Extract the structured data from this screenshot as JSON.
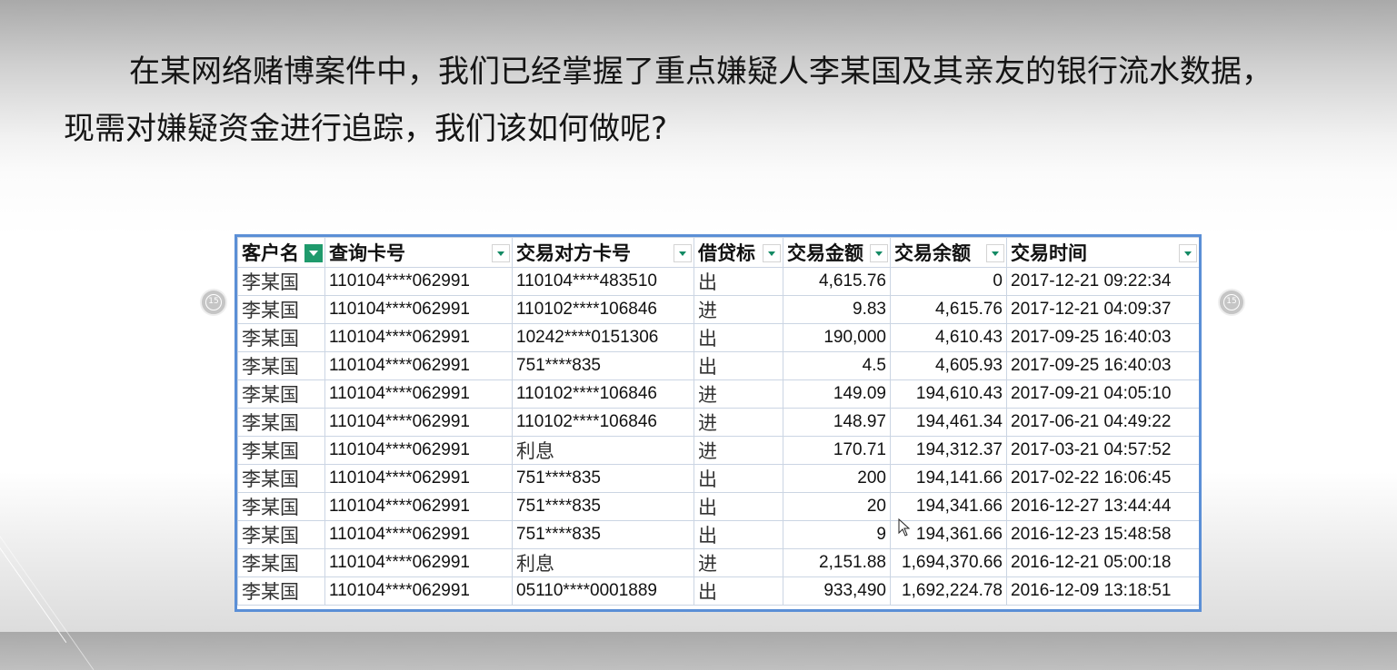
{
  "intro": {
    "line1": "在某网络赌博案件中，我们已经掌握了重点嫌疑人李某国及其亲友的银行流水数据，",
    "line2": "现需对嫌疑资金进行追踪，我们该如何做呢?"
  },
  "nav": {
    "left_label": "15",
    "right_label": "15"
  },
  "table": {
    "headers": [
      "客户名",
      "查询卡号",
      "交易对方卡号",
      "借贷标",
      "交易金额",
      "交易余额",
      "交易时间"
    ],
    "rows": [
      [
        "李某国",
        "110104****062991",
        "110104****483510",
        "出",
        "4,615.76",
        "0",
        "2017-12-21 09:22:34"
      ],
      [
        "李某国",
        "110104****062991",
        "110102****106846",
        "进",
        "9.83",
        "4,615.76",
        "2017-12-21 04:09:37"
      ],
      [
        "李某国",
        "110104****062991",
        "10242****0151306",
        "出",
        "190,000",
        "4,610.43",
        "2017-09-25 16:40:03"
      ],
      [
        "李某国",
        "110104****062991",
        "751****835",
        "出",
        "4.5",
        "4,605.93",
        "2017-09-25 16:40:03"
      ],
      [
        "李某国",
        "110104****062991",
        "110102****106846",
        "进",
        "149.09",
        "194,610.43",
        "2017-09-21 04:05:10"
      ],
      [
        "李某国",
        "110104****062991",
        "110102****106846",
        "进",
        "148.97",
        "194,461.34",
        "2017-06-21 04:49:22"
      ],
      [
        "李某国",
        "110104****062991",
        "利息",
        "进",
        "170.71",
        "194,312.37",
        "2017-03-21 04:57:52"
      ],
      [
        "李某国",
        "110104****062991",
        "751****835",
        "出",
        "200",
        "194,141.66",
        "2017-02-22 16:06:45"
      ],
      [
        "李某国",
        "110104****062991",
        "751****835",
        "出",
        "20",
        "194,341.66",
        "2016-12-27 13:44:44"
      ],
      [
        "李某国",
        "110104****062991",
        "751****835",
        "出",
        "9",
        "194,361.66",
        "2016-12-23 15:48:58"
      ],
      [
        "李某国",
        "110104****062991",
        "利息",
        "进",
        "2,151.88",
        "1,694,370.66",
        "2016-12-21 05:00:18"
      ],
      [
        "李某国",
        "110104****062991",
        "05110****0001889",
        "出",
        "933,490",
        "1,692,224.78",
        "2016-12-09 13:18:51"
      ]
    ]
  },
  "colors": {
    "table_border": "#5b8fd6",
    "filter_active": "#1f9a6c",
    "filter_arrow": "#138a64"
  }
}
